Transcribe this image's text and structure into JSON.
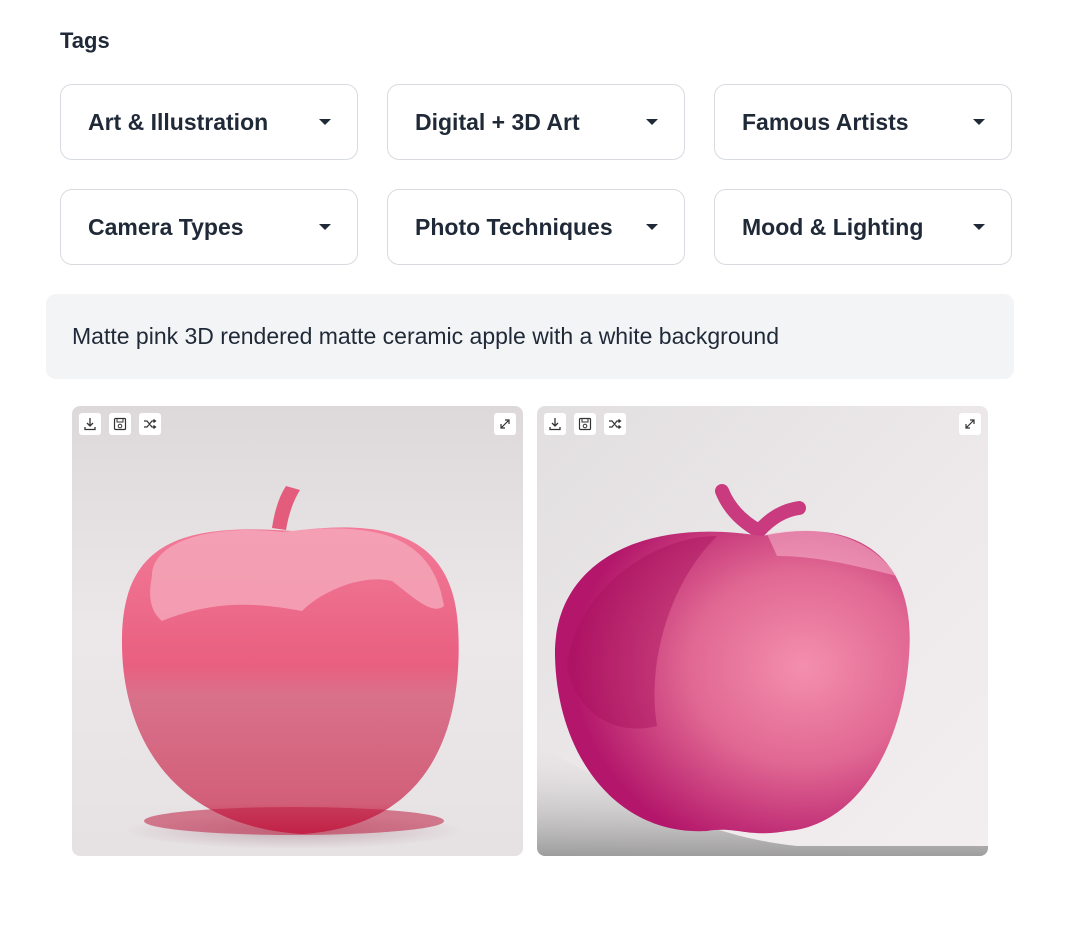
{
  "tags": {
    "title": "Tags",
    "dropdowns": [
      {
        "label": "Art & Illustration"
      },
      {
        "label": "Digital + 3D Art"
      },
      {
        "label": "Famous Artists"
      },
      {
        "label": "Camera Types"
      },
      {
        "label": "Photo Techniques"
      },
      {
        "label": "Mood & Lighting"
      }
    ]
  },
  "prompt": {
    "text": "Matte pink 3D rendered matte ceramic apple with a white background"
  },
  "images": [
    {
      "description": "Glossy pink 3D apple render"
    },
    {
      "description": "Matte magenta 3D apple render with shadow"
    }
  ],
  "icons": {
    "download": "download-icon",
    "save": "save-icon",
    "shuffle": "shuffle-icon",
    "expand": "expand-icon",
    "caret": "chevron-down-icon"
  },
  "colors": {
    "text": "#1f2937",
    "border": "#d7dbe0",
    "prompt_bg": "#f3f4f6"
  }
}
